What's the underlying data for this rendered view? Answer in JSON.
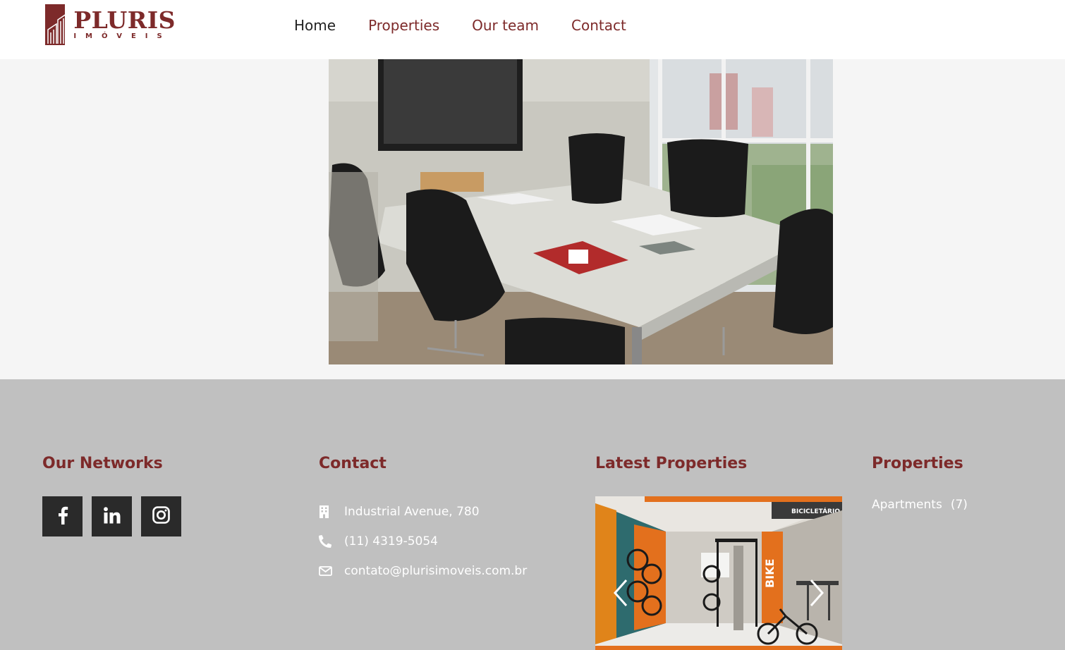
{
  "brand": {
    "name": "PLURIS",
    "tagline": "IMÓVEIS",
    "color": "#7d2a2a"
  },
  "nav": {
    "items": [
      {
        "label": "Home",
        "active": true
      },
      {
        "label": "Properties",
        "active": false
      },
      {
        "label": "Our team",
        "active": false
      },
      {
        "label": "Contact",
        "active": false
      }
    ]
  },
  "hero": {
    "image": "meeting-room-photo"
  },
  "footer": {
    "networks": {
      "title": "Our Networks",
      "icons": [
        "facebook-icon",
        "linkedin-icon",
        "instagram-icon"
      ]
    },
    "contact": {
      "title": "Contact",
      "address": "Industrial Avenue, 780",
      "phone": "(11) 4319-5054",
      "email": "contato@plurisimoveis.com.br"
    },
    "latest": {
      "title": "Latest Properties",
      "slide_label": "BICICLETÁRIO",
      "slide_sign": "BIKE"
    },
    "properties": {
      "title": "Properties",
      "items": [
        {
          "label": "Apartments",
          "count": "(7)"
        }
      ]
    }
  }
}
